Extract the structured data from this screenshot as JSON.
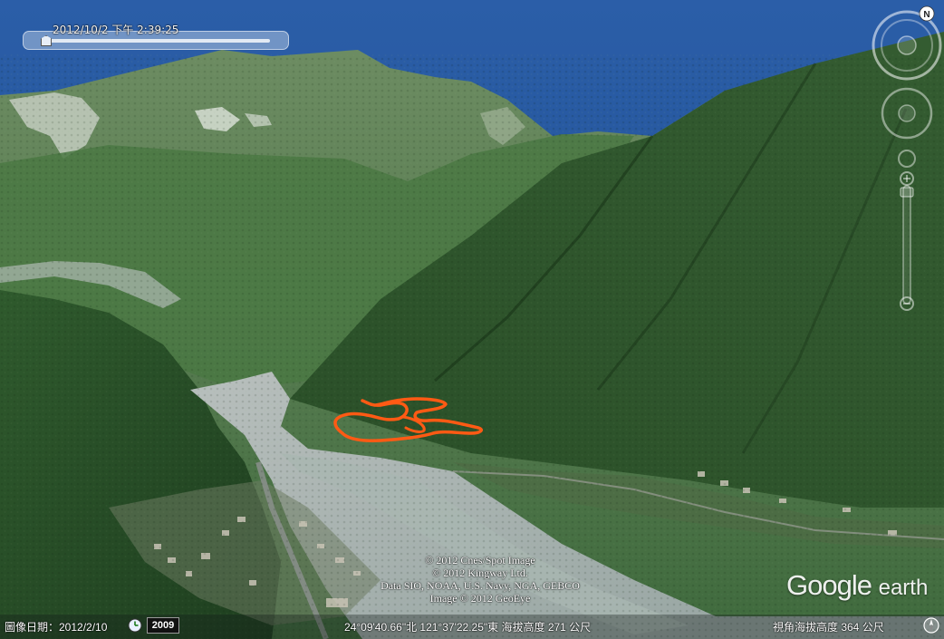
{
  "timeline": {
    "datetime": "2012/10/2 下午   2:39:25"
  },
  "navigation": {
    "north_label": "N"
  },
  "watermark": {
    "google": "Google",
    "earth": "earth"
  },
  "attribution": [
    "© 2012 Cnes/Spot Image",
    "© 2012 Kingway Ltd.",
    "Data SIO, NOAA, U.S. Navy, NGA, GEBCO",
    "Image © 2012 GeoEye"
  ],
  "status": {
    "imagery_date": "圖像日期：2012/2/10",
    "year": "2009",
    "coordinates": "24°09'40.66\"北  121°37'22.25\"東  海拔高度   271 公尺",
    "eye_altitude": "視角海拔高度     364 公尺"
  },
  "colors": {
    "sky": "#1f4f93",
    "forest_dark": "#1e3d20",
    "forest": "#3d6a3a",
    "river": "#9fa9a4",
    "gps_track": "#ff5a14"
  },
  "icons": {
    "compass": "compass-ring-icon",
    "look": "look-joystick-icon",
    "move": "move-joystick-icon",
    "zoom": "zoom-slider-icon",
    "clock": "clock-icon",
    "small_compass": "small-compass-icon"
  }
}
